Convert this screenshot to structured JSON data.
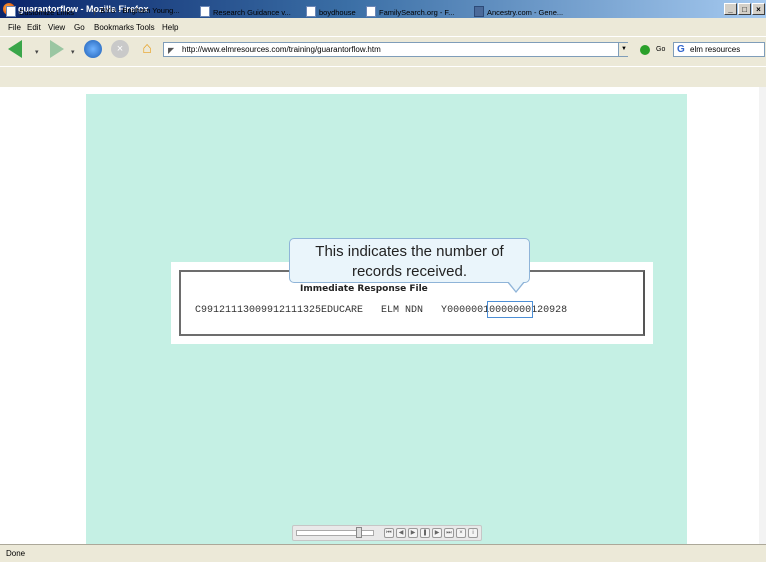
{
  "window": {
    "title": "guarantorflow - Mozilla Firefox",
    "minimize_glyph": "_",
    "maximize_glyph": "□",
    "close_glyph": "×"
  },
  "menu": [
    "File",
    "Edit",
    "View",
    "Go",
    "Bookmarks",
    "Tools",
    "Help"
  ],
  "nav": {
    "url": "http://www.elmresources.com/training/guarantorflow.htm",
    "go_label": "Go",
    "search_value": "elm resources",
    "search_engine_icon": "G"
  },
  "bookmarks": [
    "Customize Links",
    "BYU - Brigham Young...",
    "Research Guidance v...",
    "boydhouse",
    "FamilySearch.org - F...",
    "Ancestry.com - Gene..."
  ],
  "slide": {
    "panel_title": "Immediate Response File",
    "record_prefix": "C9912111300991211132",
    "record_mid": "5EDUCARE   ELM NDN   Y",
    "record_highlight": "0000001",
    "record_suffix": "0000000120928",
    "callout_text": "This indicates the number of records received."
  },
  "status": {
    "text": "Done"
  },
  "colors": {
    "stage_bg": "#c5f0e4",
    "callout_bg": "#eaf5fb",
    "highlight_border": "#4d8fd6"
  }
}
